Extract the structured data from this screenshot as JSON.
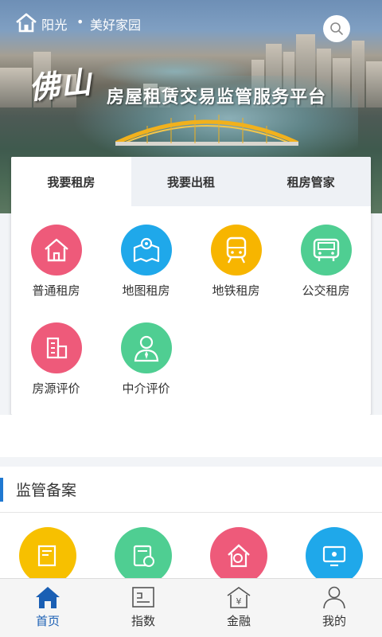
{
  "header": {
    "location_city": "阳光",
    "separator": "•",
    "location_area": "美好家园"
  },
  "banner": {
    "brand": "佛山",
    "title": "房屋租赁交易监管服务平台"
  },
  "tabs": [
    {
      "label": "我要租房",
      "active": true
    },
    {
      "label": "我要出租",
      "active": false
    },
    {
      "label": "租房管家",
      "active": false
    }
  ],
  "services": [
    {
      "label": "普通租房",
      "icon": "house-icon",
      "color": "#ee5a7a"
    },
    {
      "label": "地图租房",
      "icon": "map-icon",
      "color": "#1fa8ea"
    },
    {
      "label": "地铁租房",
      "icon": "subway-icon",
      "color": "#f7b500"
    },
    {
      "label": "公交租房",
      "icon": "bus-icon",
      "color": "#4fce92"
    },
    {
      "label": "房源评价",
      "icon": "building-icon",
      "color": "#ee5a7a"
    },
    {
      "label": "中介评价",
      "icon": "agent-icon",
      "color": "#4fce92"
    }
  ],
  "section": {
    "title": "监管备案",
    "items": [
      {
        "icon": "record-icon",
        "color": "#f7c000"
      },
      {
        "icon": "document-star-icon",
        "color": "#4fce92"
      },
      {
        "icon": "house-search-icon",
        "color": "#ee5a7a"
      },
      {
        "icon": "monitor-icon",
        "color": "#1fa8ea"
      }
    ]
  },
  "nav": [
    {
      "label": "首页",
      "icon": "home-icon",
      "active": true
    },
    {
      "label": "指数",
      "icon": "index-icon",
      "active": false
    },
    {
      "label": "金融",
      "icon": "finance-icon",
      "active": false
    },
    {
      "label": "我的",
      "icon": "user-icon",
      "active": false
    }
  ],
  "colors": {
    "accent": "#1a5fb4",
    "section_bar": "#1f78d1"
  }
}
